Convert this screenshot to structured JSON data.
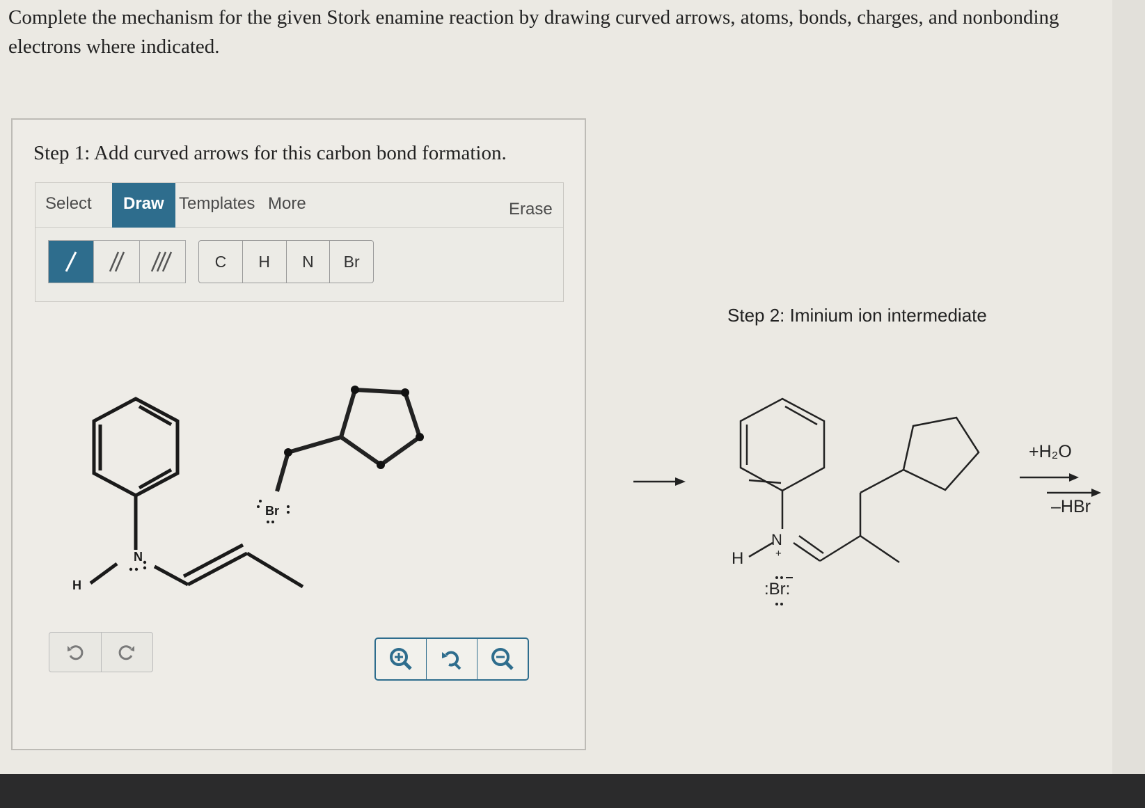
{
  "question": {
    "text": "Complete the mechanism for the given Stork enamine reaction by drawing curved arrows, atoms, bonds, charges, and nonbonding electrons where indicated."
  },
  "step1": {
    "title": "Step 1: Add curved arrows for this carbon bond formation."
  },
  "toolbar": {
    "tabs": [
      "Select",
      "Draw",
      "Templates",
      "More"
    ],
    "erase_label": "Erase",
    "active_tab": "Draw",
    "bond_buttons": [
      "single-bond",
      "double-bond",
      "triple-bond"
    ],
    "atom_buttons": [
      "C",
      "H",
      "N",
      "Br"
    ]
  },
  "molecule1": {
    "n_label": "N",
    "h_label": "H",
    "br_label": "Br"
  },
  "step2": {
    "title": "Step 2: Iminium ion intermediate",
    "n_label": "N",
    "plus": "+",
    "h_label": "H",
    "br_label": ":Br:",
    "reagent_top": "+H₂O",
    "reagent_bottom": "–HBr"
  },
  "controls": {
    "undo_icon": "undo-icon",
    "redo_icon": "redo-icon",
    "zoom_in_icon": "zoom-in-icon",
    "zoom_reset_icon": "zoom-reset-icon",
    "zoom_out_icon": "zoom-out-icon"
  },
  "colors": {
    "accent": "#2e6d8d",
    "background": "#ebe9e3"
  }
}
